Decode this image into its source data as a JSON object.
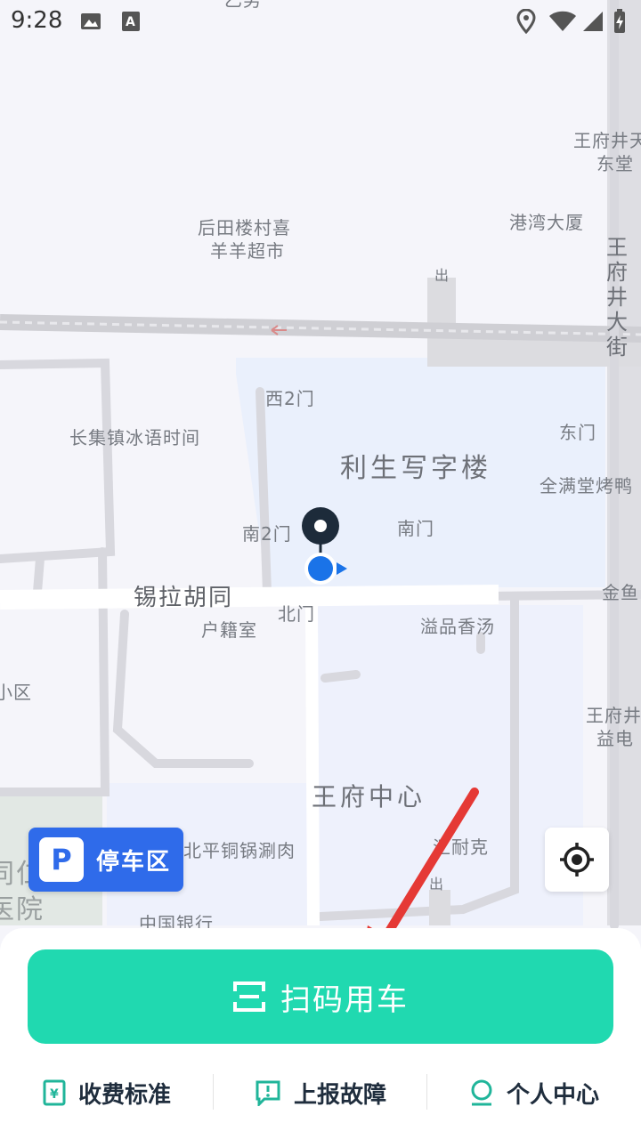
{
  "status": {
    "time": "9:28"
  },
  "map": {
    "labels": {
      "top_cut": "乙男",
      "wfj_1": "王府井天",
      "wfj_2": "东堂",
      "houtian_1": "后田楼村喜",
      "houtian_2": "羊羊超市",
      "gangwan": "港湾大厦",
      "chu_top": "出",
      "wangfujing_street": "王府井大街",
      "xi2men": "西2门",
      "changji": "长集镇冰语时间",
      "dongmen": "东门",
      "lisheng": "利生写字楼",
      "quanman": "全满堂烤鸭",
      "nan2men": "南2门",
      "nanmen": "南门",
      "jinyu": "金鱼",
      "xila": "锡拉胡同",
      "beimen": "北门",
      "huji": "户籍室",
      "yipin": "溢品香汤",
      "xiaoqu": "小区",
      "wfj_right_1": "王府井",
      "wfj_right_2": "益电",
      "wangfu_center": "王府中心",
      "beiping": "北平铜锅涮肉",
      "nike": "汇耐克",
      "chu_bottom": "出",
      "hospital_1": "同仁",
      "hospital_2": "医院",
      "bank": "中国银行"
    }
  },
  "parking": {
    "badge": "P",
    "label": "停车区"
  },
  "scan_button": {
    "label": "扫码用车"
  },
  "tabs": [
    {
      "label": "收费标准"
    },
    {
      "label": "上报故障"
    },
    {
      "label": "个人中心"
    }
  ],
  "colors": {
    "accent": "#20d9b0",
    "parking": "#2f6bea",
    "arrow": "#e53935"
  }
}
